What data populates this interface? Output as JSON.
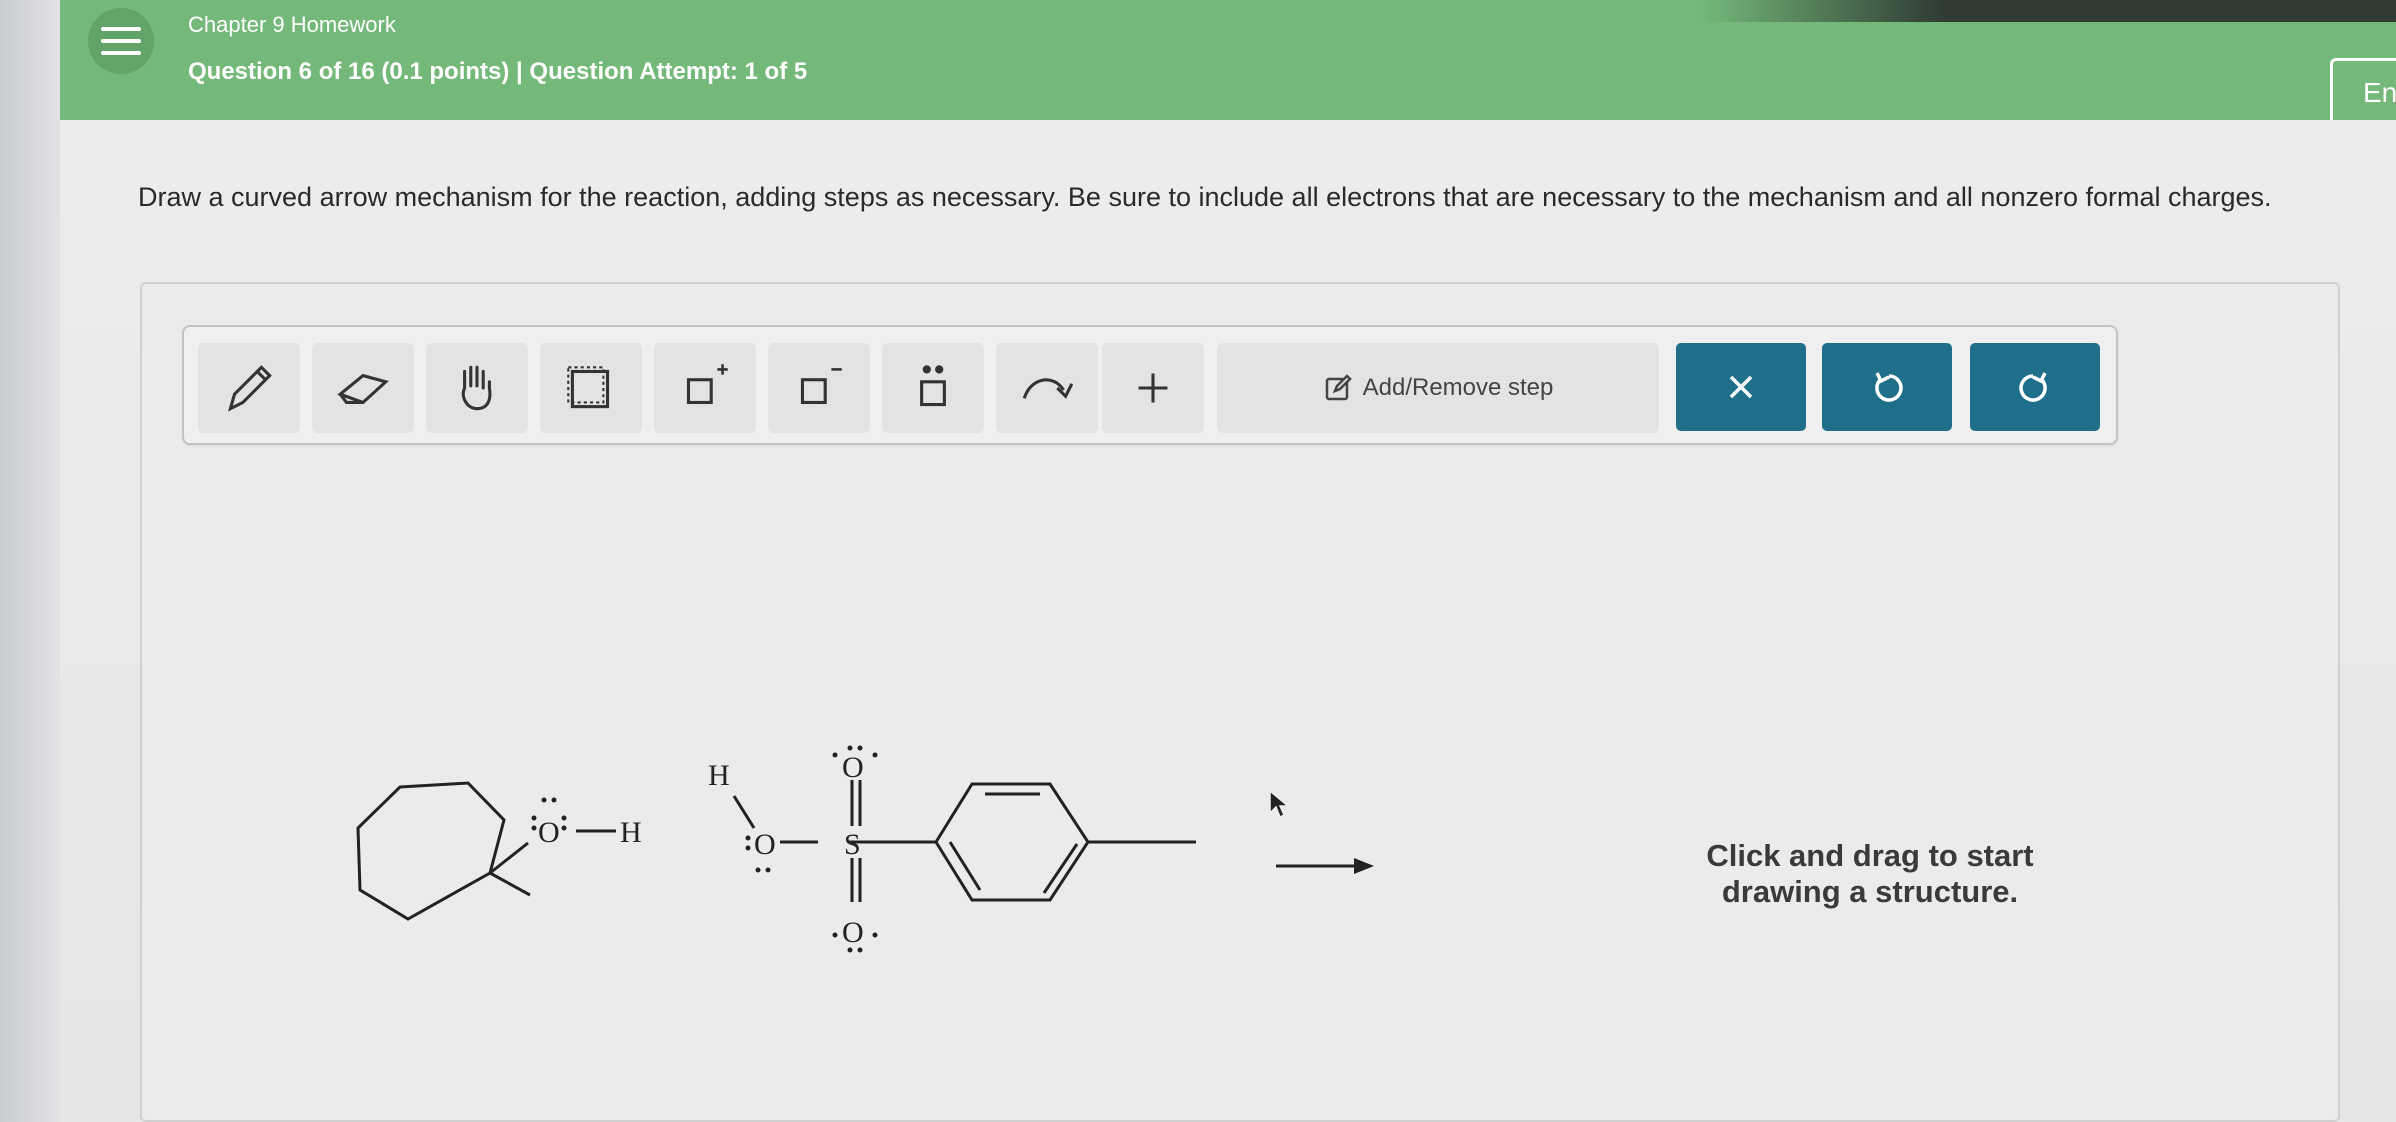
{
  "header": {
    "chapter": "Chapter 9 Homework",
    "question_info": "Question 6 of 16 (0.1 points)  |  Question Attempt: 1 of 5",
    "language_button": "En"
  },
  "question": {
    "prompt": "Draw a curved arrow mechanism for the reaction, adding steps as necessary. Be sure to include all electrons that are necessary to the mechanism and all nonzero formal charges."
  },
  "toolbar": {
    "tools": [
      "pencil-icon",
      "eraser-icon",
      "hand-icon",
      "select-box-icon",
      "positive-charge-icon",
      "negative-charge-icon",
      "lone-pair-icon",
      "curved-arrow-icon",
      "plus-icon"
    ],
    "add_remove_step": "Add/Remove step",
    "clear_button_icon": "close-icon",
    "undo_icon": "undo-icon",
    "redo_icon": "redo-icon"
  },
  "canvas": {
    "labels": {
      "alcohol_O": "O",
      "alcohol_H": "H",
      "acid_H": "H",
      "acid_O": "O",
      "sulfur": "S",
      "top_O": "O",
      "bottom_O": "O"
    },
    "hint": "Click and drag to start drawing a structure."
  },
  "colors": {
    "header_green": "#74b97a",
    "action_blue": "#1f6f8b"
  }
}
